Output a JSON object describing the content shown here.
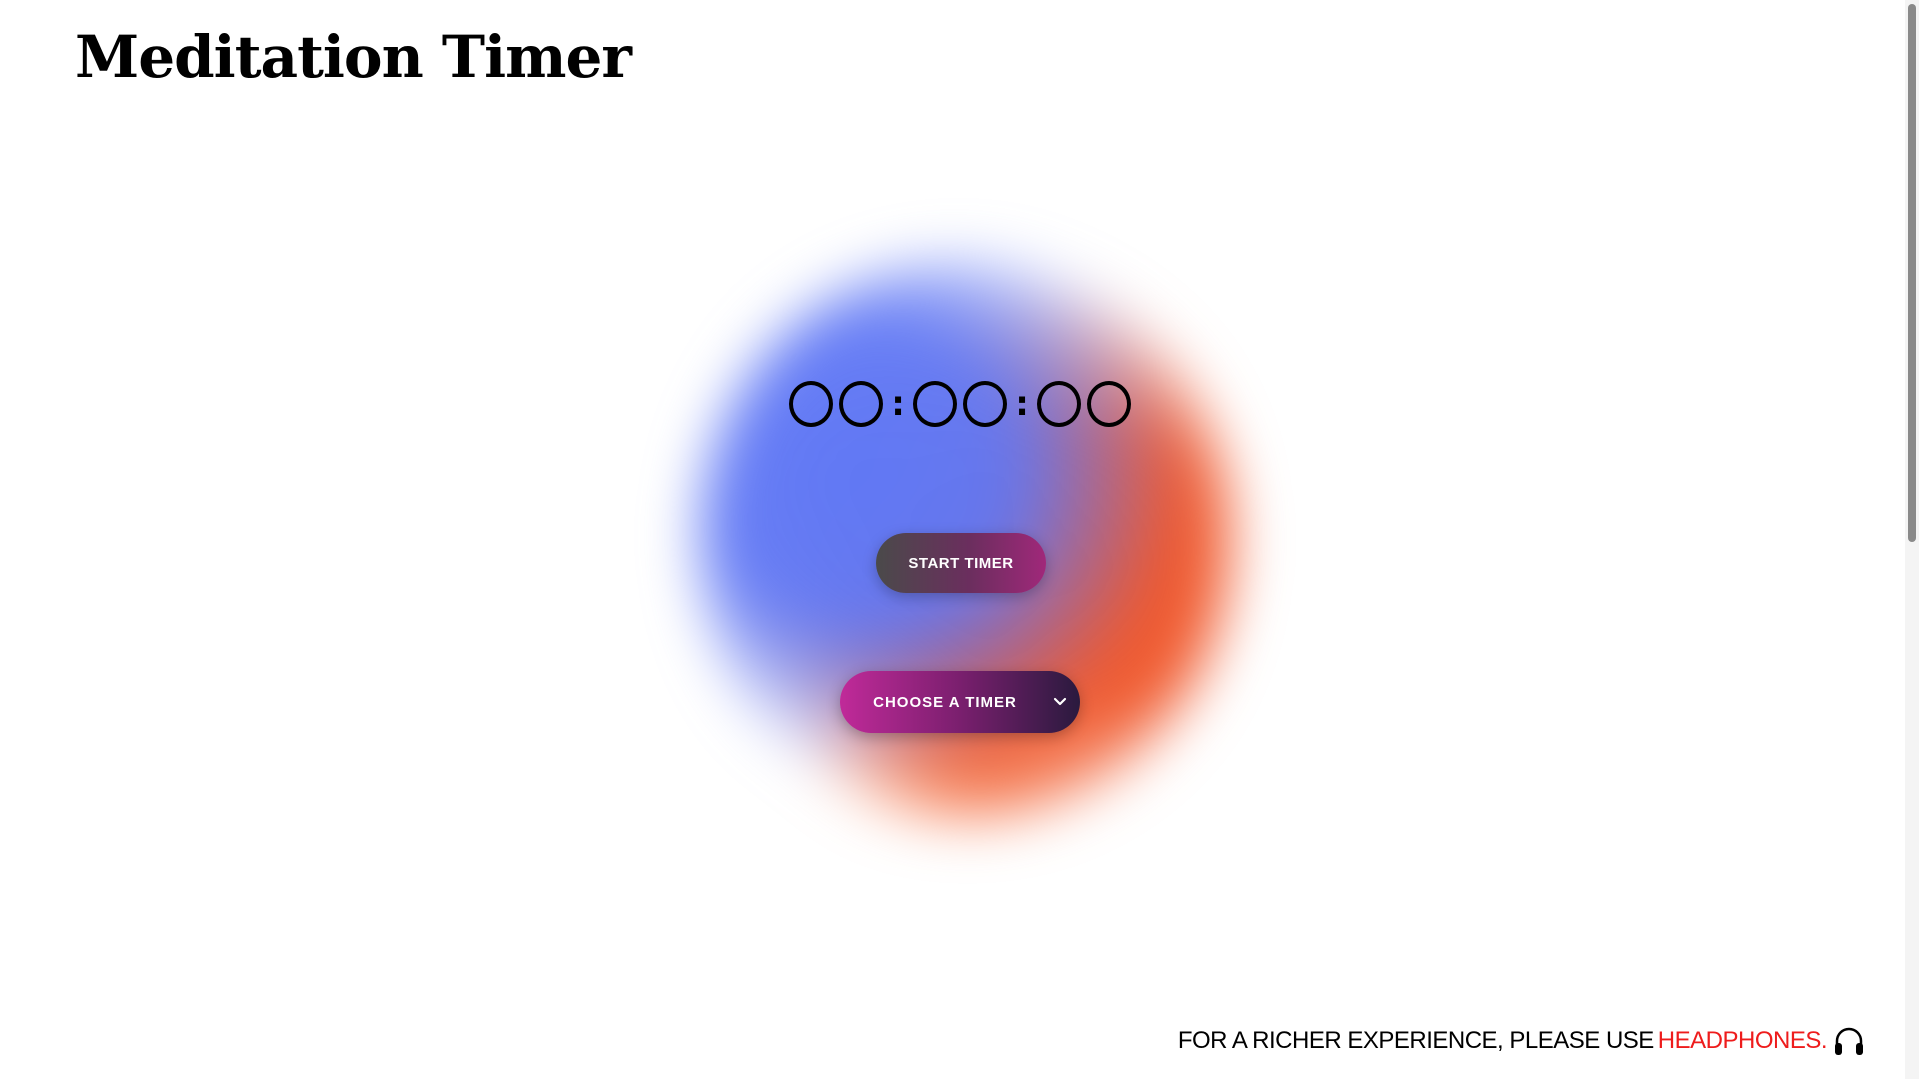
{
  "header": {
    "title": "Meditation Timer"
  },
  "timer": {
    "hours": "00",
    "minutes": "00",
    "seconds": "00",
    "separator": ":"
  },
  "controls": {
    "start_label": "START TIMER",
    "select_label": "CHOOSE A TIMER",
    "select_icon": "chevron-down-icon"
  },
  "footer": {
    "note_text": "FOR A RICHER EXPERIENCE, PLEASE USE",
    "highlight_text": "HEADPHONES.",
    "icon": "headphones-icon"
  },
  "colors": {
    "orb_blue": "#6078f5",
    "orb_orange": "#f05528",
    "highlight_red": "#ee1c1c",
    "button_magenta": "#c02a99"
  }
}
